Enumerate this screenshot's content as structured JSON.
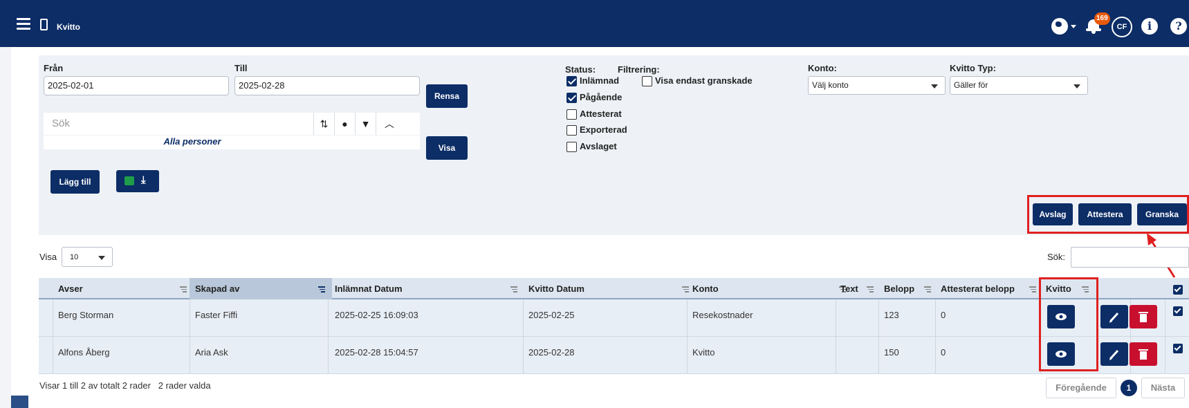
{
  "topbar": {
    "title": "Kvitto",
    "notification_count": "169",
    "user_initials": "CF",
    "info_glyph": "i",
    "help_glyph": "?"
  },
  "filters": {
    "from_label": "Från",
    "from_value": "2025-02-01",
    "to_label": "Till",
    "to_value": "2025-02-28",
    "clear_label": "Rensa",
    "show_label": "Visa",
    "search_placeholder": "Sök",
    "persons_label": "Alla personer",
    "add_label": "Lägg till",
    "status_label": "Status:",
    "status_items": [
      {
        "label": "Inlämnad",
        "checked": true
      },
      {
        "label": "Pågående",
        "checked": true
      },
      {
        "label": "Attesterat",
        "checked": false
      },
      {
        "label": "Exporterad",
        "checked": false
      },
      {
        "label": "Avslaget",
        "checked": false
      }
    ],
    "filtering_label": "Filtrering:",
    "only_reviewed_label": "Visa endast granskade",
    "account_label": "Konto:",
    "account_value": "Välj konto",
    "receipt_type_label": "Kvitto Typ:",
    "receipt_type_value": "Gäller för"
  },
  "bulk_actions": {
    "reject": "Avslag",
    "approve": "Attestera",
    "review": "Granska"
  },
  "table_controls": {
    "show_label": "Visa",
    "page_size": "10",
    "search_label": "Sök:"
  },
  "table": {
    "columns": [
      "Avser",
      "Skapad av",
      "Inlämnat Datum",
      "Kvitto Datum",
      "Konto",
      "Text",
      "Belopp",
      "Attesterat belopp",
      "Kvitto"
    ],
    "rows": [
      {
        "avser": "Berg Storman",
        "skapad_av": "Faster Fiffi",
        "inlamnat": "2025-02-25 16:09:03",
        "kvitto_datum": "2025-02-25",
        "konto": "Resekostnader",
        "text": "",
        "belopp": "123",
        "attesterat": "0"
      },
      {
        "avser": "Alfons Åberg",
        "skapad_av": "Aria Ask",
        "inlamnat": "2025-02-28 15:04:57",
        "kvitto_datum": "2025-02-28",
        "konto": "Kvitto",
        "text": "",
        "belopp": "150",
        "attesterat": "0"
      }
    ]
  },
  "footer": {
    "summary": "Visar 1 till 2 av totalt 2 rader",
    "selected": "2 rader valda",
    "prev_label": "Föregående",
    "current_page": "1",
    "next_label": "Nästa"
  },
  "colors": {
    "navy": "#0c2d66",
    "danger": "#c8102e",
    "highlight": "#e02020",
    "badge": "#e8590c"
  },
  "icons": [
    "menu-icon",
    "mobile-icon",
    "globe-icon",
    "bell-icon",
    "info-icon",
    "help-icon",
    "sort-icon",
    "person-icon",
    "filter-icon",
    "chevron-up-icon",
    "excel-icon",
    "download-icon",
    "eye-icon",
    "pencil-icon",
    "trash-icon"
  ]
}
